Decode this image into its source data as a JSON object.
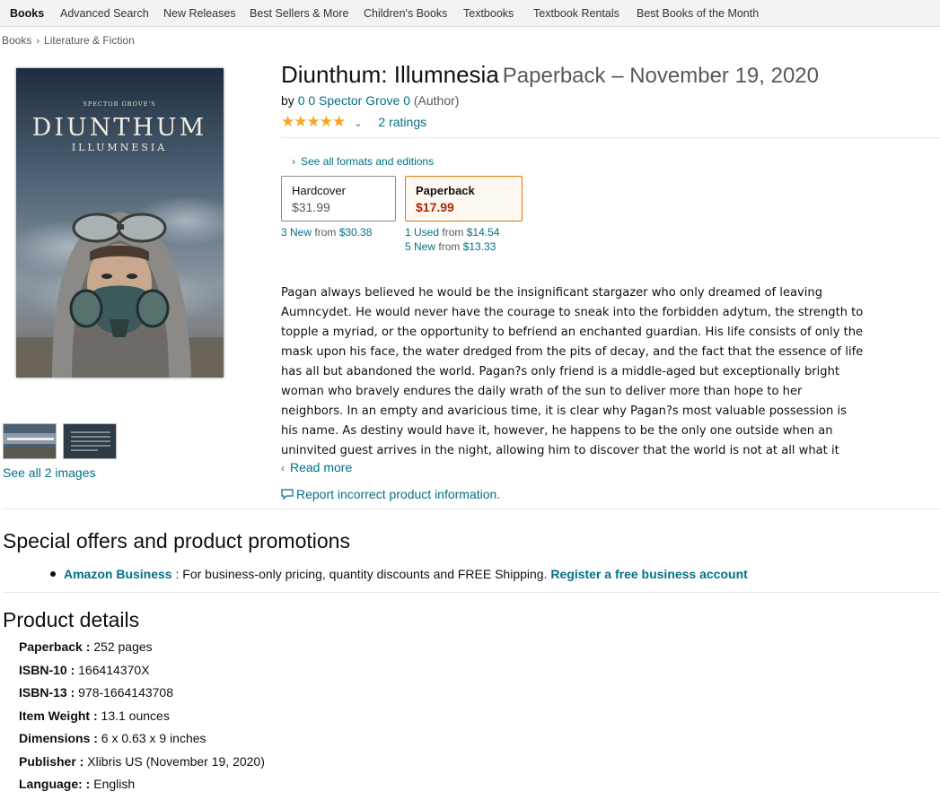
{
  "nav": {
    "items": [
      "Books",
      "Advanced Search",
      "New Releases",
      "Best Sellers & More",
      "Children's Books",
      "Textbooks",
      "Textbook Rentals",
      "Best Books of the Month"
    ]
  },
  "breadcrumb": [
    "Books",
    "Literature & Fiction"
  ],
  "product": {
    "title": "Diunthum: Illumnesia",
    "format_date": "Paperback – November 19, 2020",
    "by_label": "by",
    "author": "0 0 Spector Grove 0",
    "author_role": "(Author)",
    "stars": "★★★★★",
    "ratings": "2 ratings"
  },
  "cover": {
    "top_text": "SPECTOR GROVE'S",
    "title": "DIUNTHUM",
    "subtitle": "ILLUMNESIA"
  },
  "images": {
    "see_all": "See all 2 images"
  },
  "formats": {
    "see_all": "See all formats and editions",
    "options": [
      {
        "name": "Hardcover",
        "price": "$31.99"
      },
      {
        "name": "Paperback",
        "price": "$17.99"
      }
    ],
    "hardcover_offer": {
      "count": "3 New",
      "from": "from",
      "price": "$30.38"
    },
    "paperback_offers": [
      {
        "count": "1 Used",
        "from": "from",
        "price": "$14.54"
      },
      {
        "count": "5 New",
        "from": "from",
        "price": "$13.33"
      }
    ]
  },
  "description": {
    "text": "Pagan always believed he would be the insignificant stargazer who only dreamed of leaving Aumncydet. He would never have the courage to sneak into the forbidden adytum, the strength to topple a myriad, or the opportunity to befriend an enchanted guardian. His life consists of only the mask upon his face, the water dredged from the pits of decay, and the fact that the essence of life has all but abandoned the world. Pagan?s only friend is a middle-aged but exceptionally bright woman who bravely endures the daily wrath of the sun to deliver more than hope to her neighbors. In an empty and avaricious time, it is clear why Pagan?s most valuable possession is his name. As destiny would have it, however, he happens to be the only one outside when an uninvited guest arrives in the night, allowing him to discover that the world is not at all what it seems. Together, they begin untangling the events of the past that will",
    "read_more": "Read more"
  },
  "report": "Report incorrect product information.",
  "promotions": {
    "heading": "Special offers and product promotions",
    "item_title": "Amazon Business",
    "item_text": " : For business-only pricing, quantity discounts and FREE Shipping. ",
    "item_link": "Register a free business account"
  },
  "details": {
    "heading": "Product details",
    "rows": [
      {
        "key": "Paperback :",
        "value": "252 pages"
      },
      {
        "key": "ISBN-10 :",
        "value": "166414370X"
      },
      {
        "key": "ISBN-13 :",
        "value": "978-1664143708"
      },
      {
        "key": "Item Weight :",
        "value": "13.1 ounces"
      },
      {
        "key": "Dimensions :",
        "value": "6 x 0.63 x 9 inches"
      },
      {
        "key": "Publisher :",
        "value": "Xlibris US (November 19, 2020)"
      },
      {
        "key": "Language: :",
        "value": "English"
      }
    ]
  }
}
